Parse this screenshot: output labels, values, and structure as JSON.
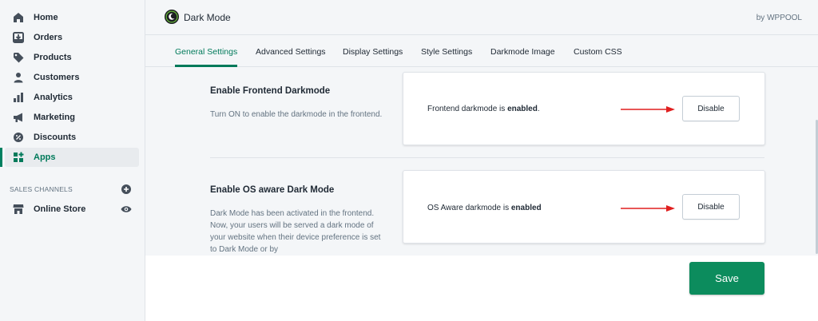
{
  "sidebar": {
    "items": [
      {
        "label": "Home",
        "icon": "home-icon"
      },
      {
        "label": "Orders",
        "icon": "orders-icon"
      },
      {
        "label": "Products",
        "icon": "tag-icon"
      },
      {
        "label": "Customers",
        "icon": "person-icon"
      },
      {
        "label": "Analytics",
        "icon": "bar-chart-icon"
      },
      {
        "label": "Marketing",
        "icon": "megaphone-icon"
      },
      {
        "label": "Discounts",
        "icon": "discount-icon"
      },
      {
        "label": "Apps",
        "icon": "apps-icon",
        "active": true
      }
    ],
    "channels_title": "SALES CHANNELS",
    "online_store": "Online Store"
  },
  "header": {
    "title": "Dark Mode",
    "by": "by WPPOOL"
  },
  "tabs": [
    {
      "label": "General Settings",
      "active": true
    },
    {
      "label": "Advanced Settings"
    },
    {
      "label": "Display Settings"
    },
    {
      "label": "Style Settings"
    },
    {
      "label": "Darkmode Image"
    },
    {
      "label": "Custom CSS"
    }
  ],
  "sections": {
    "frontend": {
      "title": "Enable Frontend Darkmode",
      "description": "Turn ON to enable the darkmode in the frontend.",
      "status_prefix": "Frontend darkmode is ",
      "status_value": "enabled",
      "status_suffix": ".",
      "button": "Disable"
    },
    "os_aware": {
      "title": "Enable OS aware Dark Mode",
      "description": "Dark Mode has been activated in the frontend. Now, your users will be served a dark mode of your website when their device preference is set to Dark Mode or by",
      "status_prefix": "OS Aware darkmode is ",
      "status_value": "enabled",
      "status_suffix": "",
      "button": "Disable"
    }
  },
  "save_label": "Save",
  "colors": {
    "accent": "#007a5a",
    "save_button": "#0c8c5d",
    "arrow": "#e01f1f"
  }
}
